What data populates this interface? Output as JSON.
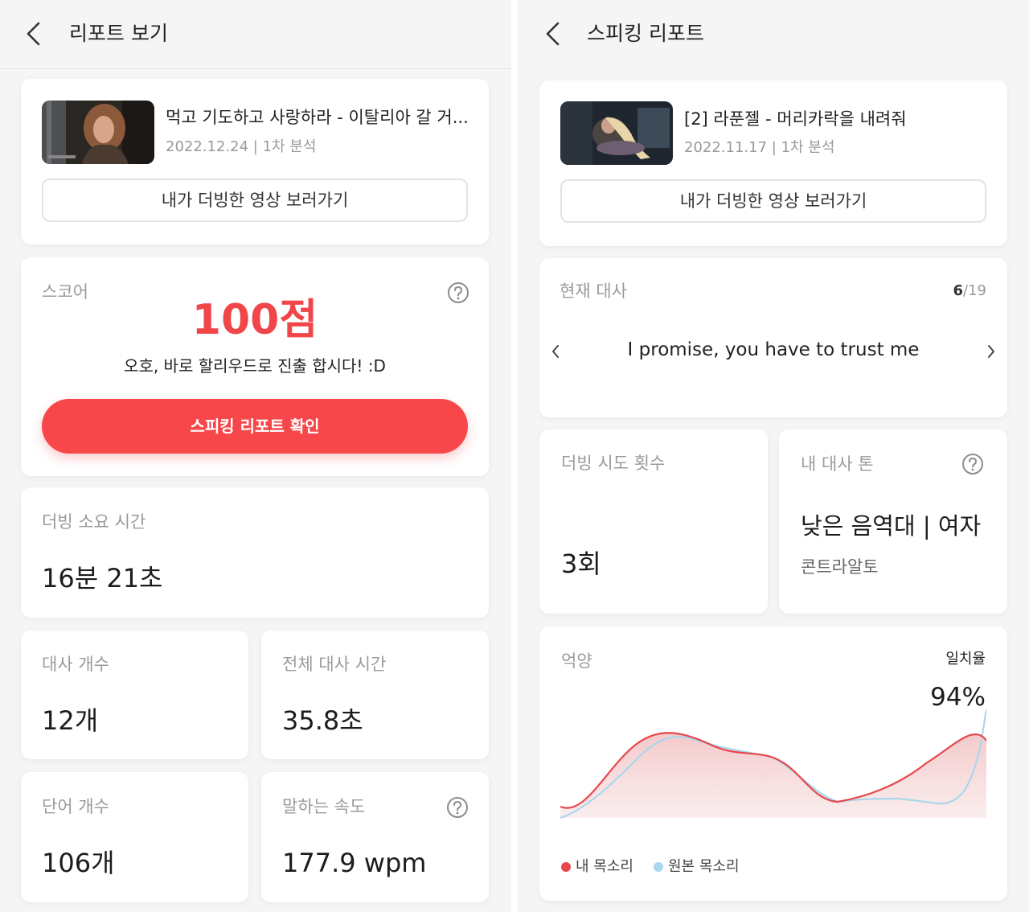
{
  "left": {
    "header": {
      "title": "리포트 보기"
    },
    "video": {
      "title": "먹고 기도하고 사랑하라 - 이탈리아 갈 거...",
      "meta": "2022.12.24 | 1차 분석",
      "button": "내가 더빙한 영상 보러가기"
    },
    "score": {
      "label": "스코어",
      "value": "100점",
      "message": "오호, 바로 할리우드로 진출 합시다! :D",
      "button": "스피킹 리포트 확인"
    },
    "dubbing_time": {
      "label": "더빙 소요 시간",
      "value": "16분 21초"
    },
    "line_count": {
      "label": "대사 개수",
      "value": "12개"
    },
    "total_line_time": {
      "label": "전체 대사 시간",
      "value": "35.8초"
    },
    "word_count": {
      "label": "단어 개수",
      "value": "106개"
    },
    "speaking_speed": {
      "label": "말하는 속도",
      "value": "177.9 wpm"
    }
  },
  "right": {
    "header": {
      "title": "스피킹 리포트"
    },
    "video": {
      "title": "[2] 라푼젤 - 머리카락을 내려줘",
      "meta": "2022.11.17 | 1차 분석",
      "button": "내가 더빙한 영상 보러가기"
    },
    "current_line": {
      "label": "현재 대사",
      "index": "6",
      "total": "/19",
      "text": "I promise, you have to trust me"
    },
    "attempts": {
      "label": "더빙 시도 횟수",
      "value": "3회"
    },
    "tone": {
      "label": "내 대사 톤",
      "value": "낮은 음역대 | 여자",
      "sub": "콘트라알토"
    },
    "intonation": {
      "label": "억양",
      "match_label": "일치율",
      "match_value": "94%",
      "legend_mine": "내 목소리",
      "legend_original": "원본 목소리",
      "color_mine": "#e8474c",
      "color_original": "#a9d7ec"
    }
  }
}
